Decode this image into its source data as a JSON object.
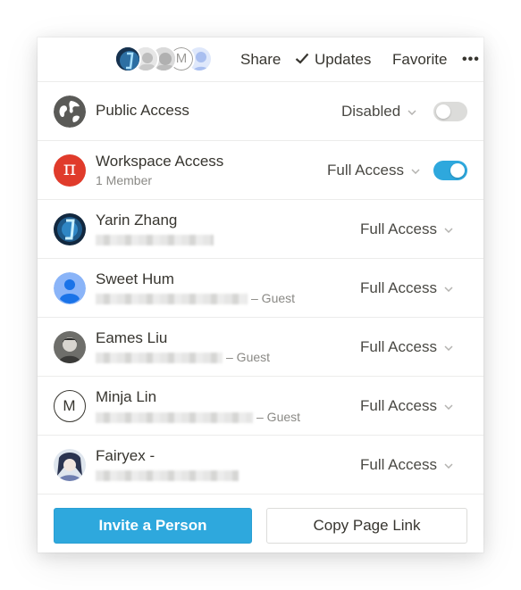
{
  "topbar": {
    "share_label": "Share",
    "updates_label": "Updates",
    "favorite_label": "Favorite",
    "more_label": "•••",
    "avatar_m_initial": "M"
  },
  "rows": {
    "public": {
      "name": "Public Access",
      "permission": "Disabled",
      "toggle_on": false
    },
    "workspace": {
      "name": "Workspace Access",
      "sub": "1 Member",
      "permission": "Full Access",
      "icon_glyph": "π",
      "toggle_on": true
    },
    "members": [
      {
        "name": "Yarin Zhang",
        "guest": "",
        "permission": "Full Access"
      },
      {
        "name": "Sweet Hum",
        "guest": "– Guest",
        "permission": "Full Access"
      },
      {
        "name": "Eames Liu",
        "guest": "– Guest",
        "permission": "Full Access"
      },
      {
        "name": "Minja Lin",
        "guest": "– Guest",
        "permission": "Full Access",
        "initial": "M"
      },
      {
        "name": "Fairyex -",
        "guest": "",
        "permission": "Full Access"
      }
    ]
  },
  "footer": {
    "invite_label": "Invite a Person",
    "copy_link_label": "Copy Page Link"
  },
  "colors": {
    "accent": "#2ea8dd",
    "workspace_icon": "#e03b2b",
    "toggle_off": "#dcdcda",
    "text": "#37352f",
    "muted": "#8a8985"
  }
}
